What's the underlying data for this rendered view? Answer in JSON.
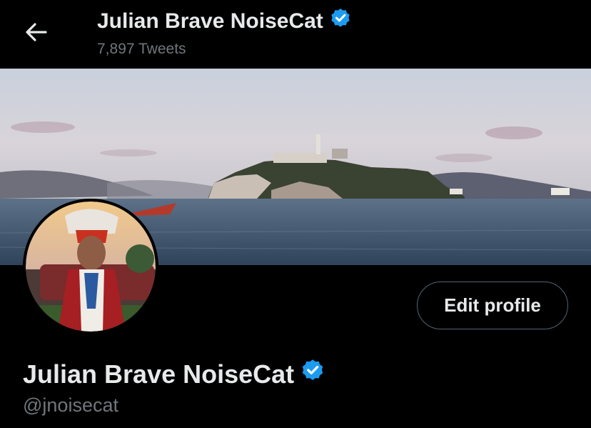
{
  "header": {
    "back_icon": "arrow-left-icon",
    "title": "Julian Brave NoiseCat",
    "tweet_count": "7,897 Tweets"
  },
  "banner": {
    "description_icon": "alcatraz-banner-image"
  },
  "profile": {
    "name": "Julian Brave NoiseCat",
    "handle": "@jnoisecat",
    "edit_label": "Edit profile",
    "verified_icon": "verified-badge-icon"
  },
  "colors": {
    "background": "#000000",
    "text": "#e7e9ea",
    "muted": "#71767b",
    "verified": "#1d9bf0",
    "border": "#536471"
  }
}
